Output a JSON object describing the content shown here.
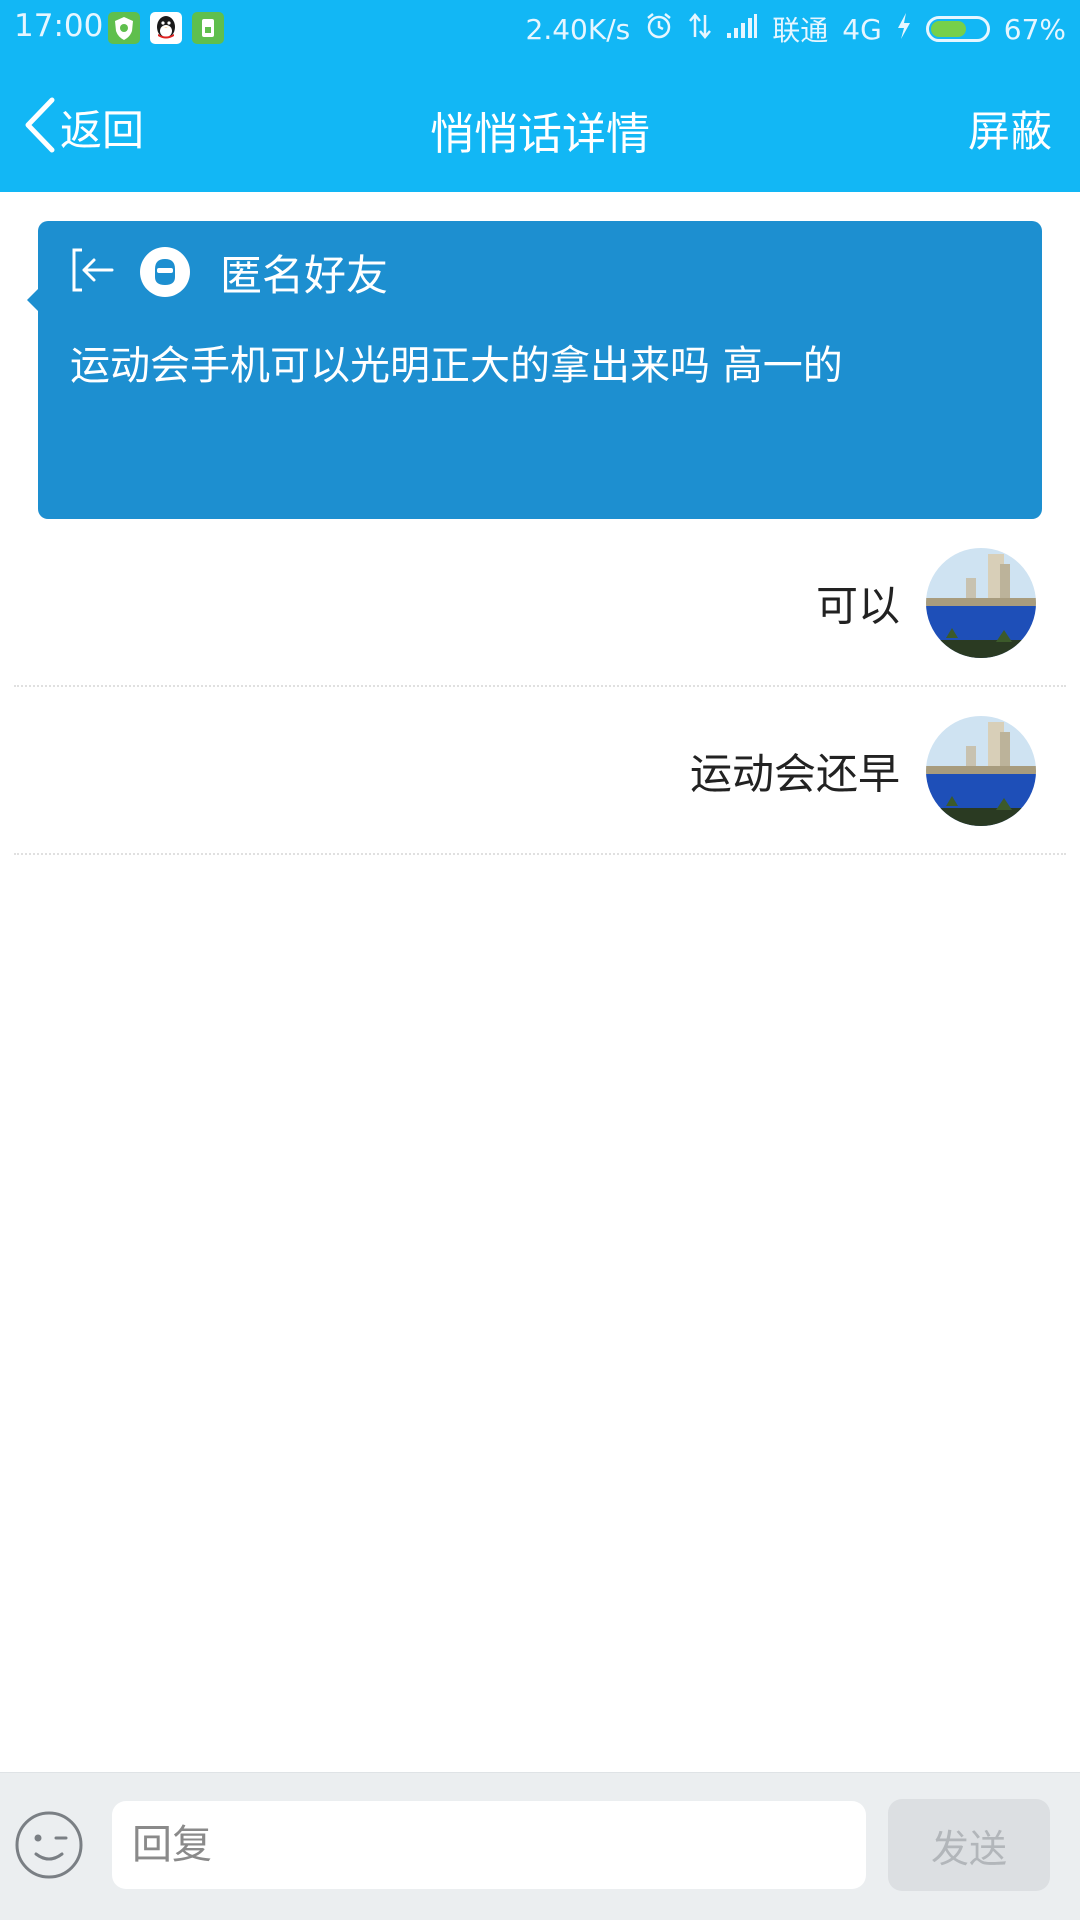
{
  "status_bar": {
    "time": "17:00",
    "network_speed": "2.40K/s",
    "carrier": "联通",
    "network_type": "4G",
    "battery": "67%",
    "battery_level": 0.67,
    "app_icons": [
      "shield-app-icon",
      "qq-penguin-icon",
      "sim-app-icon"
    ]
  },
  "nav": {
    "back_label": "返回",
    "title": "悄悄话详情",
    "action_label": "屏蔽"
  },
  "whisper": {
    "sender": "匿名好友",
    "content": "运动会手机可以光明正大的拿出来吗 高一的"
  },
  "replies": [
    {
      "text": "可以"
    },
    {
      "text": "运动会还早"
    }
  ],
  "input": {
    "placeholder": "回复",
    "value": "",
    "send_label": "发送"
  },
  "colors": {
    "header": "#12b7f5",
    "card": "#1d8fd0",
    "input_bar": "#ebeef0",
    "send_disabled": "#dcdfe2"
  }
}
